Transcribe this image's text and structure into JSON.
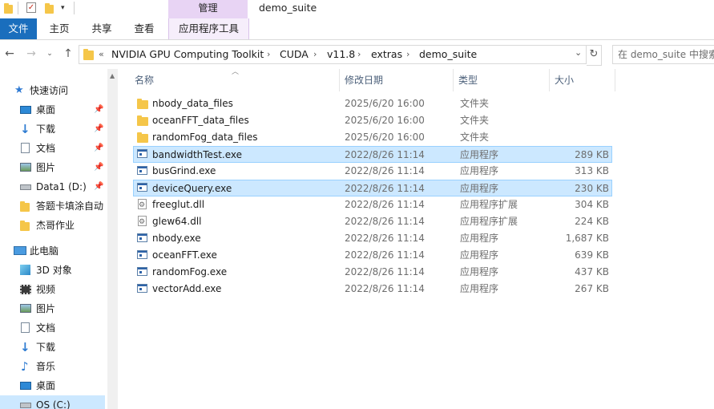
{
  "window": {
    "title": "demo_suite",
    "contextual_group": "管理"
  },
  "ribbon": {
    "tabs": [
      "文件",
      "主页",
      "共享",
      "查看",
      "应用程序工具"
    ]
  },
  "address": {
    "prefix": "«",
    "crumbs": [
      "NVIDIA GPU Computing Toolkit",
      "CUDA",
      "v11.8",
      "extras",
      "demo_suite"
    ],
    "separator": "›",
    "dropdown": "⌄",
    "refresh": "↻"
  },
  "search": {
    "placeholder": "在 demo_suite 中搜索"
  },
  "sidebar": {
    "items": [
      {
        "label": "快速访问",
        "icon": "star-icon",
        "pinned": false
      },
      {
        "label": "桌面",
        "icon": "desktop-icon",
        "pinned": true
      },
      {
        "label": "下载",
        "icon": "download-icon",
        "pinned": true
      },
      {
        "label": "文档",
        "icon": "document-icon",
        "pinned": true
      },
      {
        "label": "图片",
        "icon": "picture-icon",
        "pinned": true
      },
      {
        "label": "Data1 (D:)",
        "icon": "drive-icon",
        "pinned": true
      },
      {
        "label": "答题卡填涂自动",
        "icon": "folder-icon",
        "pinned": false
      },
      {
        "label": "杰哥作业",
        "icon": "folder-icon",
        "pinned": false
      },
      {
        "label": "此电脑",
        "icon": "computer-icon",
        "pinned": false
      },
      {
        "label": "3D 对象",
        "icon": "cube-icon",
        "pinned": false
      },
      {
        "label": "视频",
        "icon": "video-icon",
        "pinned": false
      },
      {
        "label": "图片",
        "icon": "picture-icon",
        "pinned": false
      },
      {
        "label": "文档",
        "icon": "document-icon",
        "pinned": false
      },
      {
        "label": "下载",
        "icon": "download-icon",
        "pinned": false
      },
      {
        "label": "音乐",
        "icon": "music-icon",
        "pinned": false
      },
      {
        "label": "桌面",
        "icon": "desktop-icon",
        "pinned": false
      },
      {
        "label": "OS (C:)",
        "icon": "drive-icon",
        "pinned": false
      }
    ]
  },
  "columns": [
    "名称",
    "修改日期",
    "类型",
    "大小"
  ],
  "files": [
    {
      "name": "nbody_data_files",
      "date": "2025/6/20 16:00",
      "type": "文件夹",
      "size": "",
      "icon": "folder-icon"
    },
    {
      "name": "oceanFFT_data_files",
      "date": "2025/6/20 16:00",
      "type": "文件夹",
      "size": "",
      "icon": "folder-icon"
    },
    {
      "name": "randomFog_data_files",
      "date": "2025/6/20 16:00",
      "type": "文件夹",
      "size": "",
      "icon": "folder-icon"
    },
    {
      "name": "bandwidthTest.exe",
      "date": "2022/8/26 11:14",
      "type": "应用程序",
      "size": "289 KB",
      "icon": "exe-icon"
    },
    {
      "name": "busGrind.exe",
      "date": "2022/8/26 11:14",
      "type": "应用程序",
      "size": "313 KB",
      "icon": "exe-icon"
    },
    {
      "name": "deviceQuery.exe",
      "date": "2022/8/26 11:14",
      "type": "应用程序",
      "size": "230 KB",
      "icon": "exe-icon"
    },
    {
      "name": "freeglut.dll",
      "date": "2022/8/26 11:14",
      "type": "应用程序扩展",
      "size": "304 KB",
      "icon": "dll-icon"
    },
    {
      "name": "glew64.dll",
      "date": "2022/8/26 11:14",
      "type": "应用程序扩展",
      "size": "224 KB",
      "icon": "dll-icon"
    },
    {
      "name": "nbody.exe",
      "date": "2022/8/26 11:14",
      "type": "应用程序",
      "size": "1,687 KB",
      "icon": "exe-icon"
    },
    {
      "name": "oceanFFT.exe",
      "date": "2022/8/26 11:14",
      "type": "应用程序",
      "size": "639 KB",
      "icon": "exe-icon"
    },
    {
      "name": "randomFog.exe",
      "date": "2022/8/26 11:14",
      "type": "应用程序",
      "size": "437 KB",
      "icon": "exe-icon"
    },
    {
      "name": "vectorAdd.exe",
      "date": "2022/8/26 11:14",
      "type": "应用程序",
      "size": "267 KB",
      "icon": "exe-icon"
    }
  ],
  "selected_files": [
    "bandwidthTest.exe",
    "deviceQuery.exe"
  ],
  "colors": {
    "accent": "#1a6ebd",
    "selection": "#cce8ff",
    "contextual_tab": "#e8d4f4",
    "folder": "#f5c649"
  }
}
